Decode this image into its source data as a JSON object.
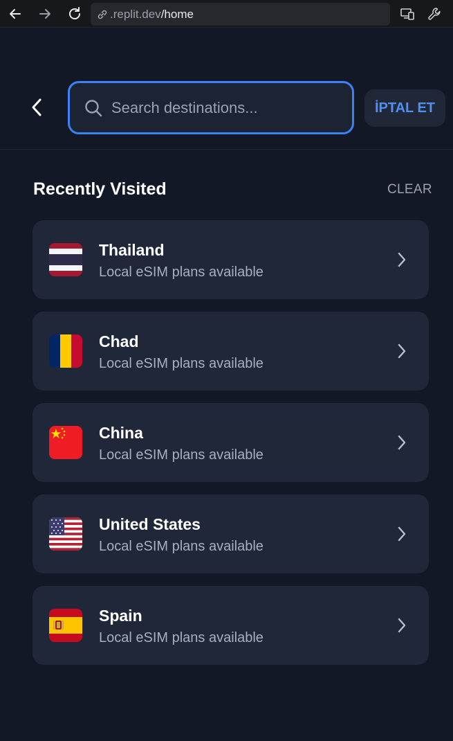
{
  "browser": {
    "url_host": ".replit.dev",
    "url_path": "/home"
  },
  "search": {
    "placeholder": "Search destinations...",
    "value": "",
    "cancel_label": "İPTAL ET"
  },
  "recent": {
    "title": "Recently Visited",
    "clear_label": "CLEAR",
    "items": [
      {
        "name": "Thailand",
        "subtitle": "Local eSIM plans available",
        "flag": "thailand-flag"
      },
      {
        "name": "Chad",
        "subtitle": "Local eSIM plans available",
        "flag": "chad-flag"
      },
      {
        "name": "China",
        "subtitle": "Local eSIM plans available",
        "flag": "china-flag"
      },
      {
        "name": "United States",
        "subtitle": "Local eSIM plans available",
        "flag": "us-flag"
      },
      {
        "name": "Spain",
        "subtitle": "Local eSIM plans available",
        "flag": "spain-flag"
      }
    ]
  },
  "colors": {
    "background": "#121826",
    "card": "#1f2738",
    "accent": "#3b82f6"
  }
}
